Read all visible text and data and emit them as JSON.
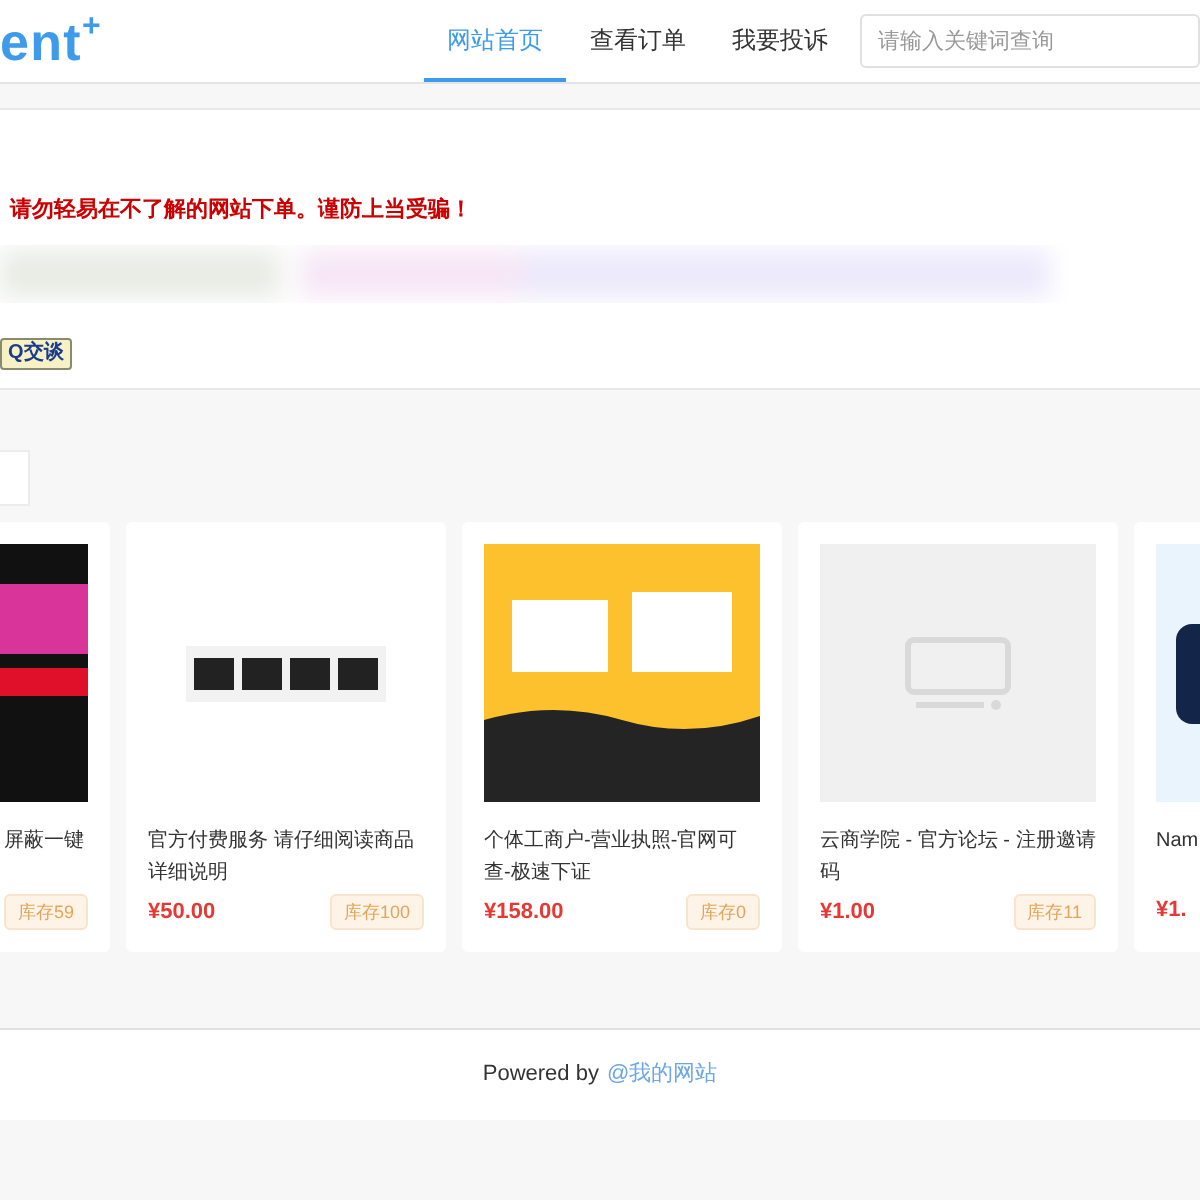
{
  "header": {
    "logo": {
      "text": "ent",
      "mark": "+"
    },
    "nav": [
      {
        "label": "网站首页",
        "selected": true
      },
      {
        "label": "查看订单",
        "selected": false
      },
      {
        "label": "我要投诉",
        "selected": false
      }
    ],
    "search": {
      "placeholder": "请输入关键词查询"
    }
  },
  "notice": {
    "warning": "请勿轻易在不了解的网站下单。谨防上当受骗！",
    "chat_button": "Q交谈"
  },
  "products": [
    {
      "title": "屏蔽一键",
      "stock": "库存59"
    },
    {
      "title": "官方付费服务 请仔细阅读商品详细说明",
      "price": "¥50.00",
      "stock": "库存100"
    },
    {
      "title": "个体工商户-营业执照-官网可查-极速下证",
      "price": "¥158.00",
      "stock": "库存0"
    },
    {
      "title": "云商学院 - 官方论坛 - 注册邀请码",
      "price": "¥1.00",
      "stock": "库存11"
    },
    {
      "title": "Nam",
      "price": "¥1."
    }
  ],
  "footer": {
    "text": "Powered by",
    "link": "@我的网站"
  }
}
